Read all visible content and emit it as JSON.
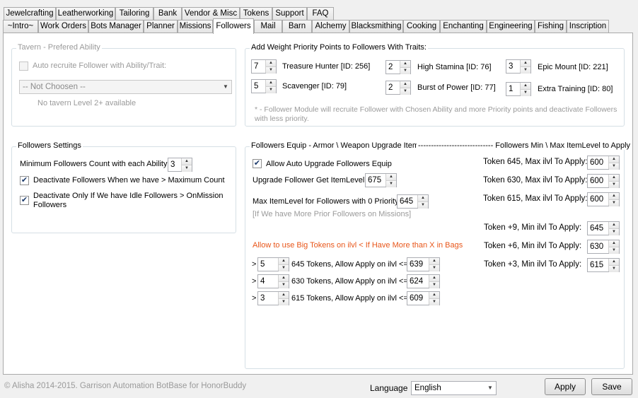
{
  "tabs_row1": [
    "Jewelcrafting",
    "Leatherworking",
    "Tailoring",
    "Bank",
    "Vendor & Misc",
    "Tokens",
    "Support",
    "FAQ"
  ],
  "tabs_row2": [
    "~Intro~",
    "Work Orders",
    "Bots Manager",
    "Planner",
    "Missions",
    "Followers",
    "Mail",
    "Barn",
    "Alchemy",
    "Blacksmithing",
    "Cooking",
    "Enchanting",
    "Engineering",
    "Fishing",
    "Inscription"
  ],
  "active_tab": "Followers",
  "tavern": {
    "title": "Tavern - Prefered Ability",
    "auto_recruit_label": "Auto recruite Follower with Ability/Trait:",
    "auto_recruit_checked": false,
    "ability_select": "-- Not Choosen --",
    "note": "No tavern Level 2+ available"
  },
  "weights": {
    "title": "Add Weight Priority Points to Followers With Traits:",
    "traits": [
      {
        "value": "7",
        "label": "Treasure Hunter [ID: 256]"
      },
      {
        "value": "2",
        "label": "High Stamina [ID: 76]"
      },
      {
        "value": "3",
        "label": "Epic Mount [ID: 221]"
      },
      {
        "value": "5",
        "label": "Scavenger [ID: 79]"
      },
      {
        "value": "2",
        "label": "Burst of Power [ID: 77]"
      },
      {
        "value": "1",
        "label": "Extra Training [ID: 80]"
      }
    ],
    "note_line1": "* - Follower Module will recruite Follower with Chosen Ability and more Priority points and deactivate Followers",
    "note_line2": "with less priority."
  },
  "settings": {
    "title": "Followers Settings",
    "min_count_label": "Minimum Followers Count with each Ability:",
    "min_count_value": "3",
    "deactivate_label": "Deactivate Followers When we have > Maximum Count",
    "deactivate_checked": true,
    "idle_label_line1": "Deactivate  Only If We have Idle Followers > OnMission",
    "idle_label_line2": "Followers",
    "idle_checked": true
  },
  "equip": {
    "title": "Followers Equip - Armor \\ Weapon Upgrade Item",
    "title_right": "----------------------------- Followers Min \\ Max ItemLevel to Apply",
    "auto_upgrade_label": "Allow Auto Upgrade Followers Equip",
    "auto_upgrade_checked": true,
    "get_ilvl_label": "Upgrade Follower Get ItemLevel:",
    "get_ilvl_value": "675",
    "max_ilvl_label": "Max ItemLevel for Followers with 0 Priority:",
    "max_ilvl_value": "645",
    "max_ilvl_note": "[If We have More Prior Followers on Missions]",
    "big_tokens_label": "Allow to use Big Tokens on ilvl < If Have More than X in Bags",
    "big_tokens": [
      {
        "prefix": ">",
        "count": "5",
        "label": "645 Tokens, Allow Apply on ilvl <=",
        "ilvl": "639"
      },
      {
        "prefix": ">",
        "count": "4",
        "label": "630 Tokens, Allow Apply on ilvl <=",
        "ilvl": "624"
      },
      {
        "prefix": ">",
        "count": "3",
        "label": "615 Tokens, Allow Apply on ilvl <=",
        "ilvl": "609"
      }
    ],
    "max_tokens": [
      {
        "label": "Token 645,  Max ilvl To Apply:",
        "value": "600"
      },
      {
        "label": "Token 630,  Max ilvl To Apply:",
        "value": "600"
      },
      {
        "label": "Token 615,  Max ilvl To Apply:",
        "value": "600"
      }
    ],
    "min_tokens": [
      {
        "label": "Token +9,  Min ilvl To Apply:",
        "value": "645"
      },
      {
        "label": "Token +6,  Min ilvl To Apply:",
        "value": "630"
      },
      {
        "label": "Token +3,  Min ilvl To Apply:",
        "value": "615"
      }
    ]
  },
  "footer": {
    "copyright": "© Alisha 2014-2015. Garrison Automation BotBase for HonorBuddy",
    "language_label": "Language",
    "language_value": "English",
    "apply_label": "Apply",
    "save_label": "Save"
  },
  "colors": {
    "accent_orange": "#e8561a",
    "note_gray": "#9a9a9a"
  }
}
